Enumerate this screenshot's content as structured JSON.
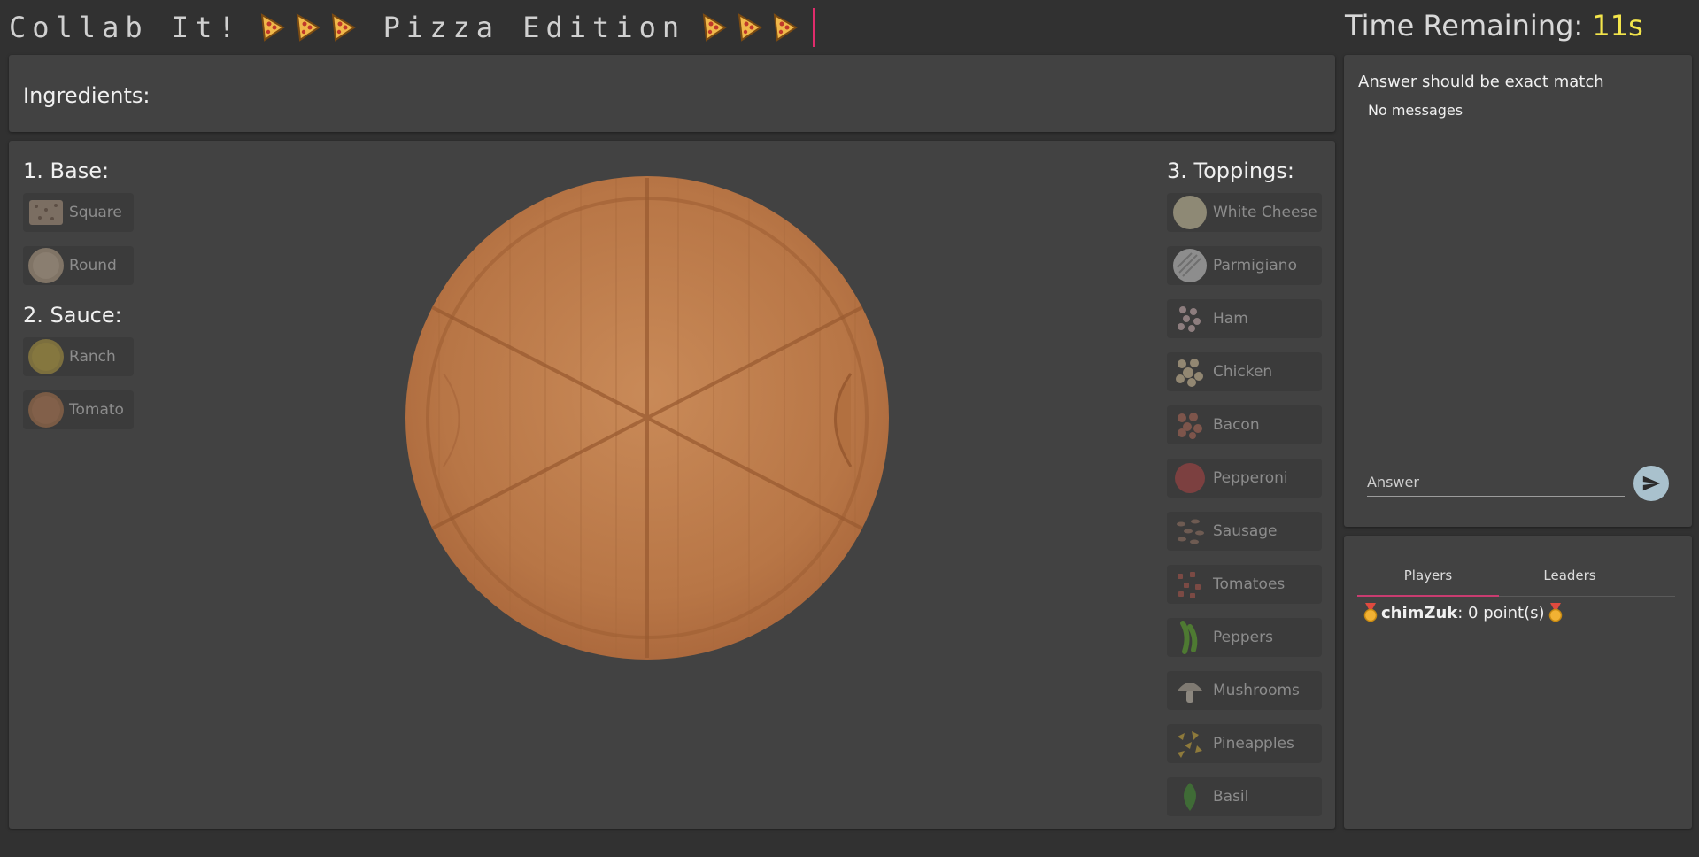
{
  "header": {
    "title_left": "Collab It!",
    "title_right": "Pizza Edition",
    "timer_label": "Time Remaining:",
    "timer_value": "11s"
  },
  "ingredients": {
    "heading": "Ingredients:"
  },
  "base": {
    "heading": "1. Base:",
    "options": [
      {
        "label": "Square",
        "icon": "square-base-icon"
      },
      {
        "label": "Round",
        "icon": "round-base-icon"
      }
    ]
  },
  "sauce": {
    "heading": "2. Sauce:",
    "options": [
      {
        "label": "Ranch",
        "icon": "ranch-sauce-icon"
      },
      {
        "label": "Tomato",
        "icon": "tomato-sauce-icon"
      }
    ]
  },
  "toppings": {
    "heading": "3. Toppings:",
    "options": [
      {
        "label": "White Cheese"
      },
      {
        "label": "Parmigiano"
      },
      {
        "label": "Ham"
      },
      {
        "label": "Chicken"
      },
      {
        "label": "Bacon"
      },
      {
        "label": "Pepperoni"
      },
      {
        "label": "Sausage"
      },
      {
        "label": "Tomatoes"
      },
      {
        "label": "Peppers"
      },
      {
        "label": "Mushrooms"
      },
      {
        "label": "Pineapples"
      },
      {
        "label": "Basil"
      }
    ]
  },
  "chat": {
    "hint": "Answer should be exact match",
    "empty": "No messages",
    "placeholder": "Answer"
  },
  "scores": {
    "tabs": [
      "Players",
      "Leaders"
    ],
    "player_name": "chimZuk",
    "player_points": ": 0 point(s)"
  },
  "colors": {
    "accent": "#c93c70",
    "timer_value": "#f3e54b",
    "panel": "#424242",
    "background": "#313131"
  }
}
